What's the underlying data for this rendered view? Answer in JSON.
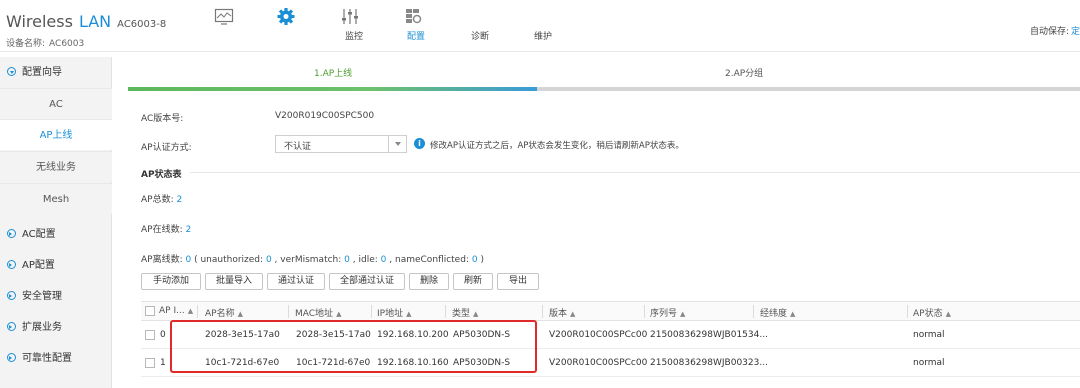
{
  "header": {
    "brand_prefix": "Wireless",
    "brand_accent": "LAN",
    "model": "AC6003-8",
    "device_label": "设备名称:",
    "device_name": "AC6003",
    "nav": [
      {
        "label": "监控",
        "icon": "monitor-icon"
      },
      {
        "label": "配置",
        "icon": "gear-icon",
        "active": true
      },
      {
        "label": "诊断",
        "icon": "sliders-icon"
      },
      {
        "label": "维护",
        "icon": "maintenance-icon"
      }
    ],
    "autosave_label": "自动保存:",
    "autosave_link": "定"
  },
  "sidebar": {
    "items": [
      {
        "label": "配置向导",
        "type": "group",
        "open": true
      },
      {
        "label": "AC",
        "type": "sub"
      },
      {
        "label": "AP上线",
        "type": "sub",
        "active": true
      },
      {
        "label": "无线业务",
        "type": "sub"
      },
      {
        "label": "Mesh",
        "type": "sub"
      },
      {
        "label": "AC配置",
        "type": "group"
      },
      {
        "label": "AP配置",
        "type": "group"
      },
      {
        "label": "安全管理",
        "type": "group"
      },
      {
        "label": "扩展业务",
        "type": "group"
      },
      {
        "label": "可靠性配置",
        "type": "group"
      }
    ]
  },
  "wizard": {
    "steps": [
      "1.AP上线",
      "2.AP分组"
    ],
    "progress_fraction": 0.43
  },
  "form": {
    "version_label": "AC版本号:",
    "version_value": "V200R019C00SPC500",
    "auth_label": "AP认证方式:",
    "auth_selected": "不认证",
    "auth_info": "修改AP认证方式之后，AP状态会发生变化，稍后请刷新AP状态表。"
  },
  "status": {
    "title": "AP状态表",
    "total_label": "AP总数:",
    "total": "2",
    "online_label": "AP在线数:",
    "online": "2",
    "offline_label": "AP离线数:",
    "offline": "0",
    "offline_detail_open": "( unauthorized:",
    "unauthorized": "0",
    "vermismatch_label": ", verMismatch:",
    "vermismatch": "0",
    "idle_label": ", idle:",
    "idle": "0",
    "nameconflict_label": ", nameConflicted:",
    "nameconflict": "0",
    "close": ")"
  },
  "toolbar": [
    "手动添加",
    "批量导入",
    "通过认证",
    "全部通过认证",
    "删除",
    "刷新",
    "导出"
  ],
  "table": {
    "headers": [
      "AP I...",
      "AP名称",
      "MAC地址",
      "IP地址",
      "类型",
      "版本",
      "序列号",
      "经纬度",
      "AP状态"
    ],
    "rows": [
      {
        "id": "0",
        "name": "2028-3e15-17a0",
        "mac": "2028-3e15-17a0",
        "ip": "192.168.10.200",
        "type": "AP5030DN-S",
        "version": "V200R010C00SPCc00",
        "serial": "21500836298WJB01534...",
        "geo": "",
        "status": "normal"
      },
      {
        "id": "1",
        "name": "10c1-721d-67e0",
        "mac": "10c1-721d-67e0",
        "ip": "192.168.10.160",
        "type": "AP5030DN-S",
        "version": "V200R010C00SPCc00",
        "serial": "21500836298WJB00323...",
        "geo": "",
        "status": "normal"
      }
    ]
  },
  "colors": {
    "accent": "#1a8fd6",
    "step_active": "#4a9e2e",
    "highlight": "#e02a2a"
  }
}
